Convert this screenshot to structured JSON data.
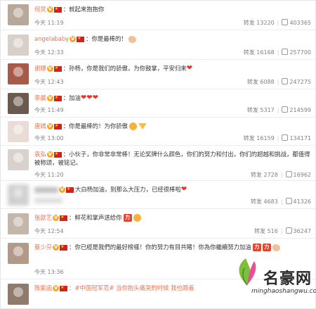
{
  "comments": [
    {
      "name": "何炅",
      "text": "：就起来抱抱你",
      "time": "今天 11:19",
      "reposts": "",
      "repost_count": "13220",
      "likes": "403365",
      "extra": []
    },
    {
      "name": "angelababy",
      "text": "：你是最棒的！",
      "time": "今天 12:33",
      "reposts": "转发",
      "repost_count": "16168",
      "likes": "257700",
      "extra": [
        "arm"
      ]
    },
    {
      "name": "谢娜",
      "text": "：孙杨，你是我们的骄傲，为你鼓掌，平安归来",
      "time": "今天 12:43",
      "reposts": "转发",
      "repost_count": "6088",
      "likes": "247275",
      "extra": [
        "heart"
      ]
    },
    {
      "name": "李晨",
      "text": "：加油",
      "time": "今天 11:49",
      "reposts": "转发",
      "repost_count": "5317",
      "likes": "214599",
      "extra": [
        "heart",
        "heart",
        "heart"
      ]
    },
    {
      "name": "唐嫣",
      "text": "：你是最棒的！为你骄傲",
      "time": "今天 13:00",
      "reposts": "转发",
      "repost_count": "16159",
      "likes": "134171",
      "extra": [
        "flower",
        "arrow"
      ]
    },
    {
      "name": "袁弘",
      "text": "：小伙子，你非常非常棒！无论奖牌什么颜色，你们的努力和付出，你们的超越和挑战，都值得被称颂，被铭记。",
      "time": "今天 11:20",
      "reposts": "转发",
      "repost_count": "2728",
      "likes": "16962",
      "extra": []
    },
    {
      "name": "",
      "text": "大白杨加油，别那么大压力，已经很棒啦",
      "time": "",
      "reposts": "转发",
      "repost_count": "4683",
      "likes": "41326",
      "extra": [
        "heart"
      ]
    },
    {
      "name": "张歆艺",
      "text": "：鲜花和掌声送给你",
      "time": "今天 12:54",
      "reposts": "转发",
      "repost_count": "516",
      "likes": "36247",
      "extra": [
        "li",
        "flower"
      ]
    },
    {
      "name": "蔡少芬",
      "text": "：你已經是我們的最好榜樣！你的努力有目共睹！你為你繼續努力加油",
      "time": "今天 13:36",
      "reposts": "",
      "repost_count": "",
      "likes": "",
      "extra": [
        "li",
        "li",
        "arm"
      ]
    },
    {
      "name": "陈紫函",
      "text": "：#中国冠军范# 当你抱头痛哭的时候 我也跟着",
      "time": "",
      "reposts": "",
      "repost_count": "",
      "likes": "",
      "extra": []
    }
  ],
  "watermark": {
    "title": "名豪网",
    "url": "minghaoshangwu.com"
  },
  "colors": {
    "name": "#eb7350",
    "meta": "#808080",
    "flag": "#d3221e",
    "badge": "#f5a623"
  }
}
